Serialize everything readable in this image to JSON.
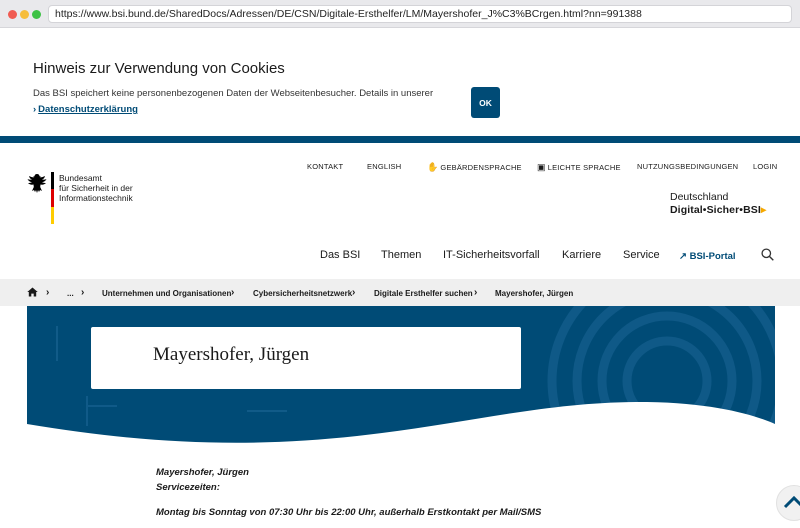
{
  "browser": {
    "url": "https://www.bsi.bund.de/SharedDocs/Adressen/DE/CSN/Digitale-Ersthelfer/LM/Mayershofer_J%C3%BCrgen.html?nn=991388"
  },
  "cookie": {
    "title": "Hinweis zur Verwendung von Cookies",
    "text": "Das BSI speichert keine personenbezogenen Daten der Webseitenbesucher. Details in unserer",
    "link_arrow": "›",
    "link": "Datenschutzerklärung",
    "ok_label": "OK"
  },
  "logo": {
    "line1": "Bundesamt",
    "line2": "für Sicherheit in der",
    "line3": "Informationstechnik",
    "flag_colors": [
      "#000000",
      "#dd0000",
      "#ffcc00"
    ]
  },
  "meta_nav": {
    "kontakt": "KONTAKT",
    "english": "ENGLISH",
    "gebaerden": "GEBÄRDENSPRACHE",
    "leichte": "LEICHTE SPRACHE",
    "nutzung": "NUTZUNGSBEDINGUNGEN",
    "login": "LOGIN"
  },
  "campaign": {
    "line1": "Deutschland",
    "word1": "Digital",
    "word2": "Sicher",
    "word3": "BSI"
  },
  "main_nav": {
    "das_bsi": "Das BSI",
    "themen": "Themen",
    "it_vorfall": "IT-Sicherheitsvorfall",
    "karriere": "Karriere",
    "service": "Service",
    "portal": "BSI-Portal"
  },
  "breadcrumb": {
    "ellipsis": "...",
    "item1": "Unternehmen und Organisationen",
    "item2": "Cybersicherheitsnetzwerk",
    "item3": "Digitale Ersthelfer suchen",
    "current": "Mayershofer, Jürgen",
    "separator": "›"
  },
  "hero": {
    "title": "Mayershofer, Jürgen"
  },
  "content": {
    "name": "Mayershofer, Jürgen",
    "service_label": "Servicezeiten:",
    "hours": "Montag bis Sonntag von 07:30 Uhr bis 22:00 Uhr, außerhalb Erstkontakt per Mail/SMS"
  },
  "colors": {
    "brand_blue": "#004b76",
    "accent_gold": "#f5a800"
  }
}
